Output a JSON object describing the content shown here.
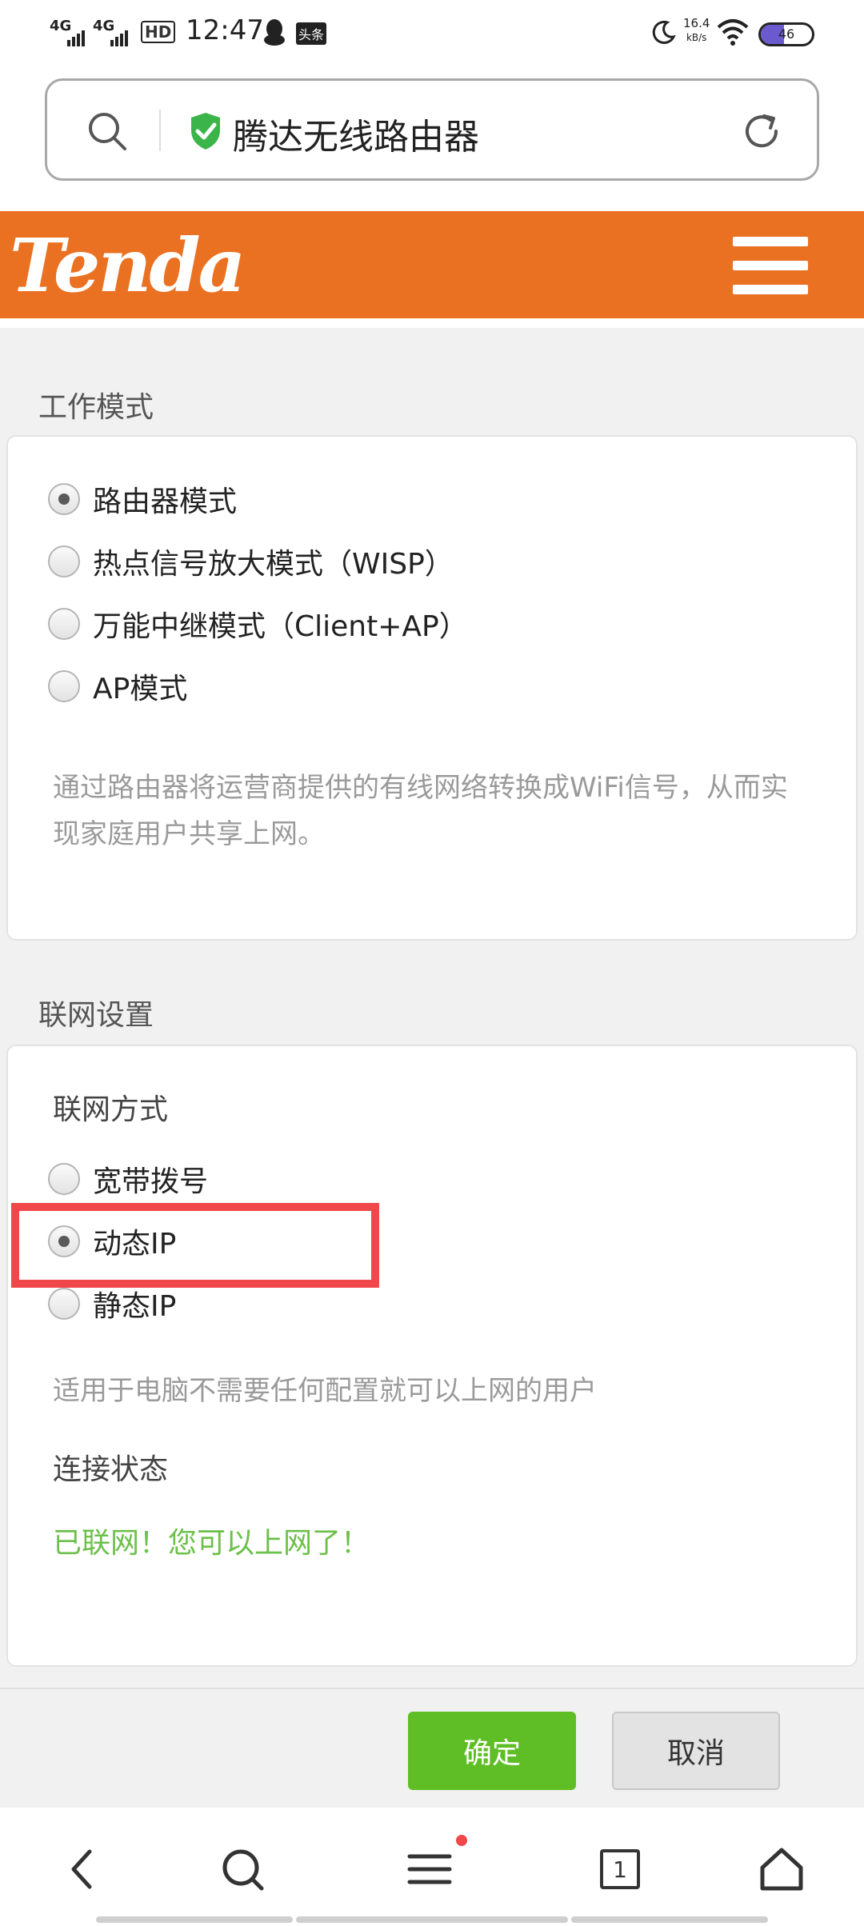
{
  "status_bar": {
    "network1": "4G",
    "network2": "4G",
    "hd": "HD",
    "time": "12:47",
    "app_badge": "头条",
    "speed_value": "16.4",
    "speed_unit": "kB/s",
    "battery": "46"
  },
  "address_bar": {
    "title": "腾达无线路由器"
  },
  "header": {
    "logo": "Tenda"
  },
  "work_mode": {
    "section_title": "工作模式",
    "options": [
      {
        "label": "路由器模式",
        "checked": true
      },
      {
        "label": "热点信号放大模式（WISP）",
        "checked": false
      },
      {
        "label": "万能中继模式（Client+AP）",
        "checked": false
      },
      {
        "label": "AP模式",
        "checked": false
      }
    ],
    "description": "通过路由器将运营商提供的有线网络转换成WiFi信号，从而实现家庭用户共享上网。"
  },
  "internet_settings": {
    "section_title": "联网设置",
    "method_label": "联网方式",
    "options": [
      {
        "label": "宽带拨号",
        "checked": false
      },
      {
        "label": "动态IP",
        "checked": true
      },
      {
        "label": "静态IP",
        "checked": false
      }
    ],
    "description": "适用于电脑不需要任何配置就可以上网的用户",
    "status_label": "连接状态",
    "status_value": "已联网！您可以上网了！",
    "status_color": "#6cc04a"
  },
  "actions": {
    "confirm": "确定",
    "cancel": "取消",
    "confirm_color": "#5fbe25"
  },
  "bottom_nav": {
    "tab_count": "1",
    "icons": [
      "back-icon",
      "search-icon",
      "menu-icon",
      "tabs-icon",
      "home-icon"
    ]
  },
  "colors": {
    "brand_orange": "#ea7122",
    "highlight_red": "#f0474a"
  }
}
